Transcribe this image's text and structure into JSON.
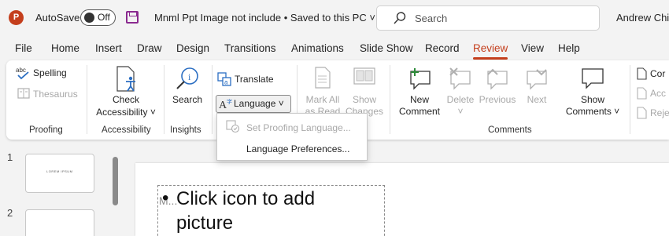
{
  "titlebar": {
    "app_icon": "P",
    "autosave_label": "AutoSave",
    "autosave_state": "Off",
    "save_icon": "save-icon",
    "doc_title": "Mnml Ppt Image not include • Saved to this PC ˅",
    "search_placeholder": "Search",
    "user_name": "Andrew Chil"
  },
  "menu": {
    "tabs": [
      "File",
      "Home",
      "Insert",
      "Draw",
      "Design",
      "Transitions",
      "Animations",
      "Slide Show",
      "Record",
      "Review",
      "View",
      "Help"
    ],
    "active_tab": "Review"
  },
  "ribbon": {
    "proofing": {
      "spelling": "Spelling",
      "thesaurus": "Thesaurus",
      "label": "Proofing"
    },
    "accessibility": {
      "check_line1": "Check",
      "check_line2": "Accessibility ˅",
      "label": "Accessibility"
    },
    "insights": {
      "search": "Search",
      "label": "Insights"
    },
    "language": {
      "translate": "Translate",
      "language": "Language ˅"
    },
    "changes": {
      "mark_all_line1": "Mark All",
      "mark_all_line2": "as Read",
      "show_changes_line1": "Show",
      "show_changes_line2": "Changes"
    },
    "comments": {
      "new_line1": "New",
      "new_line2": "Comment",
      "delete": "Delete",
      "delete_arrow": "˅",
      "previous": "Previous",
      "next": "Next",
      "show_line1": "Show",
      "show_line2": "Comments ˅",
      "label": "Comments"
    },
    "compare": {
      "item1": "Cor",
      "item2": "Acc",
      "item3": "Reje"
    }
  },
  "language_menu": {
    "set_proofing": "Set Proofing Language...",
    "preferences": "Language Preferences..."
  },
  "slides": {
    "numbers": [
      "1",
      "2"
    ],
    "thumb1_text": "LOREM IPSUM"
  },
  "canvas": {
    "placeholder_hint": "M...",
    "bullet": "•",
    "text": "Click icon to add picture"
  },
  "colors": {
    "accent": "#c43e1c",
    "ribbon_bg": "#ffffff",
    "window_bg": "#f3f3f3"
  }
}
